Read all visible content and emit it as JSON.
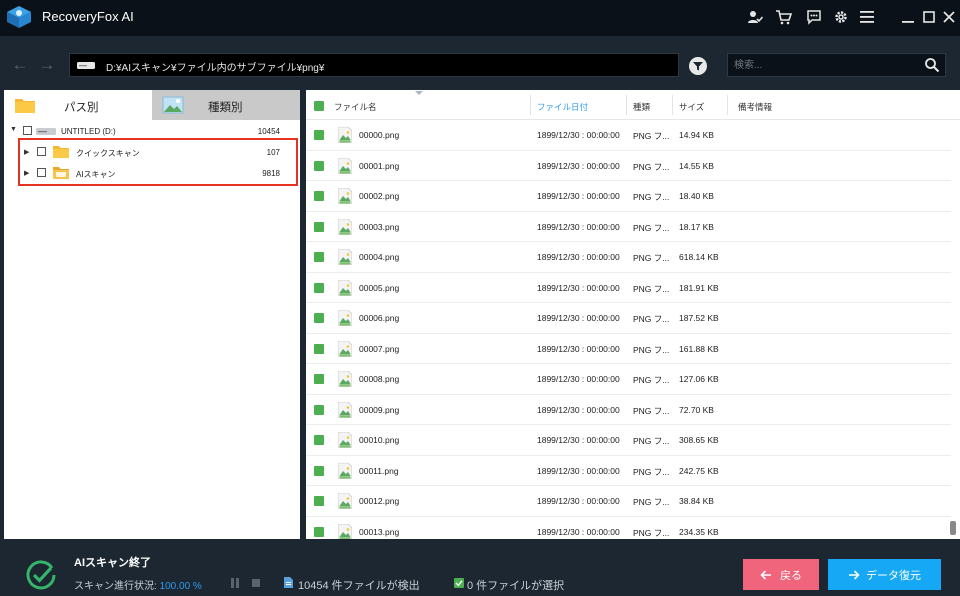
{
  "app": {
    "title": "RecoveryFox AI"
  },
  "titlebar": {
    "icons": [
      "user-check-icon",
      "cart-icon",
      "feedback-icon",
      "gear-icon",
      "menu-icon",
      "minimize-icon",
      "maximize-icon",
      "close-icon"
    ]
  },
  "address": {
    "path": "D:¥AIスキャン¥ファイル内のサブファイル¥png¥",
    "search_placeholder": "検索..."
  },
  "tabs": {
    "path_label": "パス別",
    "type_label": "種類別"
  },
  "tree": {
    "root": {
      "label": "UNTITLED (D:)",
      "count": "10454"
    },
    "children": [
      {
        "label": "クイックスキャン",
        "count": "107"
      },
      {
        "label": "AIスキャン",
        "count": "9818"
      }
    ]
  },
  "table": {
    "headers": {
      "name": "ファイル名",
      "date": "ファイル日付",
      "type": "種類",
      "size": "サイズ",
      "notes": "備考情報"
    },
    "rows": [
      {
        "name": "00000.png",
        "date": "1899/12/30 : 00:00:00",
        "type": "PNG フ...",
        "size": "14.94 KB"
      },
      {
        "name": "00001.png",
        "date": "1899/12/30 : 00:00:00",
        "type": "PNG フ...",
        "size": "14.55 KB"
      },
      {
        "name": "00002.png",
        "date": "1899/12/30 : 00:00:00",
        "type": "PNG フ...",
        "size": "18.40 KB"
      },
      {
        "name": "00003.png",
        "date": "1899/12/30 : 00:00:00",
        "type": "PNG フ...",
        "size": "18.17 KB"
      },
      {
        "name": "00004.png",
        "date": "1899/12/30 : 00:00:00",
        "type": "PNG フ...",
        "size": "618.14 KB"
      },
      {
        "name": "00005.png",
        "date": "1899/12/30 : 00:00:00",
        "type": "PNG フ...",
        "size": "181.91 KB"
      },
      {
        "name": "00006.png",
        "date": "1899/12/30 : 00:00:00",
        "type": "PNG フ...",
        "size": "187.52 KB"
      },
      {
        "name": "00007.png",
        "date": "1899/12/30 : 00:00:00",
        "type": "PNG フ...",
        "size": "161.88 KB"
      },
      {
        "name": "00008.png",
        "date": "1899/12/30 : 00:00:00",
        "type": "PNG フ...",
        "size": "127.06 KB"
      },
      {
        "name": "00009.png",
        "date": "1899/12/30 : 00:00:00",
        "type": "PNG フ...",
        "size": "72.70 KB"
      },
      {
        "name": "00010.png",
        "date": "1899/12/30 : 00:00:00",
        "type": "PNG フ...",
        "size": "308.65 KB"
      },
      {
        "name": "00011.png",
        "date": "1899/12/30 : 00:00:00",
        "type": "PNG フ...",
        "size": "242.75 KB"
      },
      {
        "name": "00012.png",
        "date": "1899/12/30 : 00:00:00",
        "type": "PNG フ...",
        "size": "38.84 KB"
      },
      {
        "name": "00013.png",
        "date": "1899/12/30 : 00:00:00",
        "type": "PNG フ...",
        "size": "234.35 KB"
      }
    ]
  },
  "status": {
    "title": "AIスキャン終了",
    "progress_label": "スキャン進行状況:",
    "progress_value": "100.00 %",
    "found_text": "10454 件ファイルが検出",
    "selected_text": "0 件ファイルが選択"
  },
  "buttons": {
    "back_label": "戻る",
    "recover_label": "データ復元"
  },
  "colors": {
    "accent_blue": "#16a8f4",
    "back_pink": "#f0647c",
    "checkbox_green": "#4caf50",
    "highlight_red": "#e53322"
  }
}
